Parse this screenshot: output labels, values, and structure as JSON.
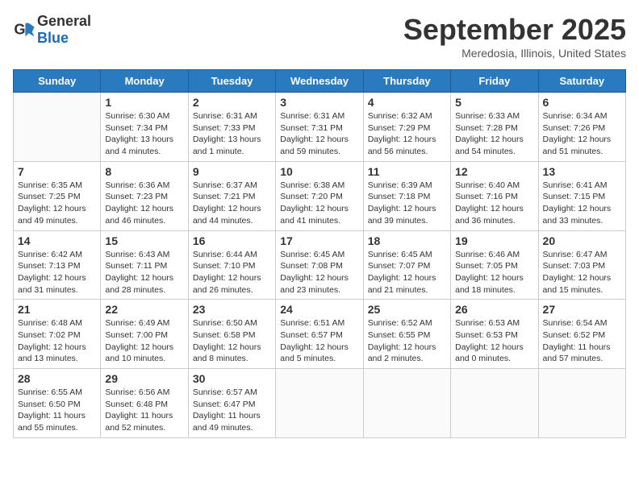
{
  "header": {
    "logo_general": "General",
    "logo_blue": "Blue",
    "month_title": "September 2025",
    "location": "Meredosia, Illinois, United States"
  },
  "days_of_week": [
    "Sunday",
    "Monday",
    "Tuesday",
    "Wednesday",
    "Thursday",
    "Friday",
    "Saturday"
  ],
  "weeks": [
    [
      {
        "day": "",
        "info": ""
      },
      {
        "day": "1",
        "info": "Sunrise: 6:30 AM\nSunset: 7:34 PM\nDaylight: 13 hours\nand 4 minutes."
      },
      {
        "day": "2",
        "info": "Sunrise: 6:31 AM\nSunset: 7:33 PM\nDaylight: 13 hours\nand 1 minute."
      },
      {
        "day": "3",
        "info": "Sunrise: 6:31 AM\nSunset: 7:31 PM\nDaylight: 12 hours\nand 59 minutes."
      },
      {
        "day": "4",
        "info": "Sunrise: 6:32 AM\nSunset: 7:29 PM\nDaylight: 12 hours\nand 56 minutes."
      },
      {
        "day": "5",
        "info": "Sunrise: 6:33 AM\nSunset: 7:28 PM\nDaylight: 12 hours\nand 54 minutes."
      },
      {
        "day": "6",
        "info": "Sunrise: 6:34 AM\nSunset: 7:26 PM\nDaylight: 12 hours\nand 51 minutes."
      }
    ],
    [
      {
        "day": "7",
        "info": "Sunrise: 6:35 AM\nSunset: 7:25 PM\nDaylight: 12 hours\nand 49 minutes."
      },
      {
        "day": "8",
        "info": "Sunrise: 6:36 AM\nSunset: 7:23 PM\nDaylight: 12 hours\nand 46 minutes."
      },
      {
        "day": "9",
        "info": "Sunrise: 6:37 AM\nSunset: 7:21 PM\nDaylight: 12 hours\nand 44 minutes."
      },
      {
        "day": "10",
        "info": "Sunrise: 6:38 AM\nSunset: 7:20 PM\nDaylight: 12 hours\nand 41 minutes."
      },
      {
        "day": "11",
        "info": "Sunrise: 6:39 AM\nSunset: 7:18 PM\nDaylight: 12 hours\nand 39 minutes."
      },
      {
        "day": "12",
        "info": "Sunrise: 6:40 AM\nSunset: 7:16 PM\nDaylight: 12 hours\nand 36 minutes."
      },
      {
        "day": "13",
        "info": "Sunrise: 6:41 AM\nSunset: 7:15 PM\nDaylight: 12 hours\nand 33 minutes."
      }
    ],
    [
      {
        "day": "14",
        "info": "Sunrise: 6:42 AM\nSunset: 7:13 PM\nDaylight: 12 hours\nand 31 minutes."
      },
      {
        "day": "15",
        "info": "Sunrise: 6:43 AM\nSunset: 7:11 PM\nDaylight: 12 hours\nand 28 minutes."
      },
      {
        "day": "16",
        "info": "Sunrise: 6:44 AM\nSunset: 7:10 PM\nDaylight: 12 hours\nand 26 minutes."
      },
      {
        "day": "17",
        "info": "Sunrise: 6:45 AM\nSunset: 7:08 PM\nDaylight: 12 hours\nand 23 minutes."
      },
      {
        "day": "18",
        "info": "Sunrise: 6:45 AM\nSunset: 7:07 PM\nDaylight: 12 hours\nand 21 minutes."
      },
      {
        "day": "19",
        "info": "Sunrise: 6:46 AM\nSunset: 7:05 PM\nDaylight: 12 hours\nand 18 minutes."
      },
      {
        "day": "20",
        "info": "Sunrise: 6:47 AM\nSunset: 7:03 PM\nDaylight: 12 hours\nand 15 minutes."
      }
    ],
    [
      {
        "day": "21",
        "info": "Sunrise: 6:48 AM\nSunset: 7:02 PM\nDaylight: 12 hours\nand 13 minutes."
      },
      {
        "day": "22",
        "info": "Sunrise: 6:49 AM\nSunset: 7:00 PM\nDaylight: 12 hours\nand 10 minutes."
      },
      {
        "day": "23",
        "info": "Sunrise: 6:50 AM\nSunset: 6:58 PM\nDaylight: 12 hours\nand 8 minutes."
      },
      {
        "day": "24",
        "info": "Sunrise: 6:51 AM\nSunset: 6:57 PM\nDaylight: 12 hours\nand 5 minutes."
      },
      {
        "day": "25",
        "info": "Sunrise: 6:52 AM\nSunset: 6:55 PM\nDaylight: 12 hours\nand 2 minutes."
      },
      {
        "day": "26",
        "info": "Sunrise: 6:53 AM\nSunset: 6:53 PM\nDaylight: 12 hours\nand 0 minutes."
      },
      {
        "day": "27",
        "info": "Sunrise: 6:54 AM\nSunset: 6:52 PM\nDaylight: 11 hours\nand 57 minutes."
      }
    ],
    [
      {
        "day": "28",
        "info": "Sunrise: 6:55 AM\nSunset: 6:50 PM\nDaylight: 11 hours\nand 55 minutes."
      },
      {
        "day": "29",
        "info": "Sunrise: 6:56 AM\nSunset: 6:48 PM\nDaylight: 11 hours\nand 52 minutes."
      },
      {
        "day": "30",
        "info": "Sunrise: 6:57 AM\nSunset: 6:47 PM\nDaylight: 11 hours\nand 49 minutes."
      },
      {
        "day": "",
        "info": ""
      },
      {
        "day": "",
        "info": ""
      },
      {
        "day": "",
        "info": ""
      },
      {
        "day": "",
        "info": ""
      }
    ]
  ]
}
